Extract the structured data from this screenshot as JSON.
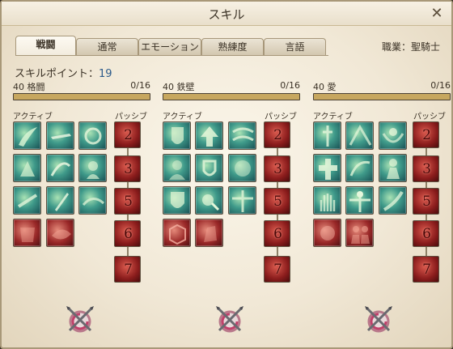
{
  "window": {
    "title": "スキル",
    "close_glyph": "✕"
  },
  "tabs": [
    {
      "label": "戦闘",
      "active": true
    },
    {
      "label": "通常",
      "active": false
    },
    {
      "label": "エモーション",
      "active": false
    },
    {
      "label": "熟練度",
      "active": false
    },
    {
      "label": "言語",
      "active": false
    }
  ],
  "job": "職業：聖騎士",
  "skill_points": {
    "label": "スキルポイント：",
    "value": "19"
  },
  "columns": [
    {
      "level": "40",
      "name": "格闘",
      "points": "0/16",
      "progress": 1.0,
      "active_label": "アクティブ",
      "passive_label": "パッシブ",
      "passives": [
        "2",
        "3",
        "5",
        "6",
        "7"
      ]
    },
    {
      "level": "40",
      "name": "鉄壁",
      "points": "0/16",
      "progress": 1.0,
      "active_label": "アクティブ",
      "passive_label": "パッシブ",
      "passives": [
        "2",
        "3",
        "5",
        "6",
        "7"
      ]
    },
    {
      "level": "40",
      "name": "愛",
      "points": "0/16",
      "progress": 1.0,
      "active_label": "アクティブ",
      "passive_label": "パッシブ",
      "passives": [
        "2",
        "3",
        "5",
        "6",
        "7"
      ]
    }
  ],
  "colors": {
    "active_icon": "#3f9a8a",
    "passive_icon": "#9a2828",
    "accent_text": "#2b5a8a"
  }
}
